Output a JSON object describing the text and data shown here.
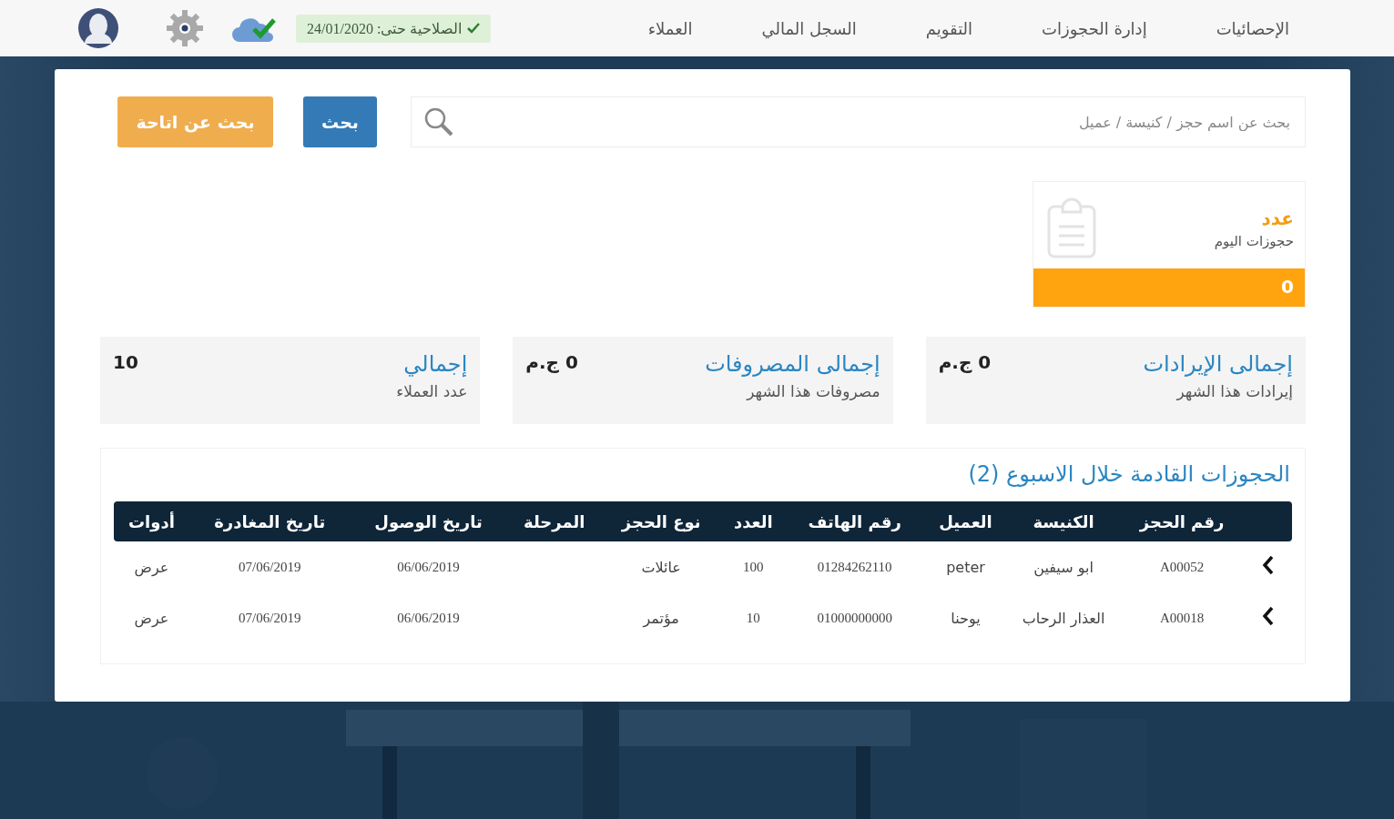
{
  "nav": {
    "items": [
      {
        "label": "الإحصائيات"
      },
      {
        "label": "إدارة الحجوزات"
      },
      {
        "label": "التقويم"
      },
      {
        "label": "السجل المالي"
      },
      {
        "label": "العملاء"
      }
    ],
    "license": "الصلاحية حتى: 24/01/2020"
  },
  "search": {
    "placeholder": "بحث عن اسم حجز / كنيسة / عميل",
    "search_button": "بحث",
    "availability_button": "بحث عن اتاحة"
  },
  "today_card": {
    "title": "عدد",
    "subtitle": "حجوزات اليوم",
    "value": "0"
  },
  "stats": [
    {
      "title": "إجمالى الإيرادات",
      "subtitle": "إيرادات هذا الشهر",
      "value": "0 ج.م"
    },
    {
      "title": "إجمالى المصروفات",
      "subtitle": "مصروفات هذا الشهر",
      "value": "0 ج.م"
    },
    {
      "title": "إجمالي",
      "subtitle": "عدد العملاء",
      "value": "10"
    }
  ],
  "bookings": {
    "title": "الحجوزات القادمة خلال الاسبوع (2)",
    "columns": [
      "رقم الحجز",
      "الكنيسة",
      "العميل",
      "رقم الهاتف",
      "العدد",
      "نوع الحجز",
      "المرحلة",
      "تاريخ الوصول",
      "تاريخ المغادرة",
      "أدوات"
    ],
    "rows": [
      {
        "number": "A00052",
        "church": "ابو سيفين",
        "client": "peter",
        "phone": "01284262110",
        "count": "100",
        "type": "عائلات",
        "arrival": "06/06/2019",
        "departure": "07/06/2019",
        "action": "عرض"
      },
      {
        "number": "A00018",
        "church": "العذار الرحاب",
        "client": "يوحنا",
        "phone": "01000000000",
        "count": "10",
        "type": "مؤتمر",
        "arrival": "06/06/2019",
        "departure": "07/06/2019",
        "action": "عرض"
      }
    ]
  }
}
